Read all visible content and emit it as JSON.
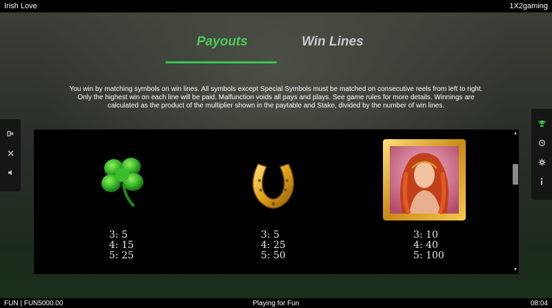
{
  "top_bar": {
    "game_title": "Irish Love",
    "provider": "1X2gaming"
  },
  "tabs": [
    {
      "label": "Payouts",
      "active": true
    },
    {
      "label": "Win Lines",
      "active": false
    }
  ],
  "description": "You win by matching symbols on win lines. All symbols except Special Symbols must be matched on consecutive reels from left to right. Only the highest win on each line will be paid. Malfunction voids all pays and plays. See game rules for more details. Winnings are calculated as the product of the multiplier shown in the paytable and Stake, divided by the number of win lines.",
  "left_panel_icons": [
    "exit-icon",
    "close-icon",
    "sound-icon"
  ],
  "right_panel_icons": [
    "trophy-icon",
    "history-icon",
    "settings-icon",
    "info-icon"
  ],
  "symbols": [
    {
      "name": "clover",
      "pays": [
        "3: 5",
        "4: 15",
        "5: 25"
      ]
    },
    {
      "name": "horseshoe",
      "pays": [
        "3: 5",
        "4: 25",
        "5: 50"
      ]
    },
    {
      "name": "red-haired-woman",
      "pays": [
        "3: 10",
        "4: 40",
        "5: 100"
      ]
    }
  ],
  "bottom_bar": {
    "balance": "FUN | FUN5000.00",
    "status": "Playing for Fun",
    "time": "08:04"
  },
  "colors": {
    "accent": "#3cc352",
    "active_tab": "#4ccb5a",
    "inactive_tab": "#c9cbc9",
    "panel": "#000000"
  }
}
